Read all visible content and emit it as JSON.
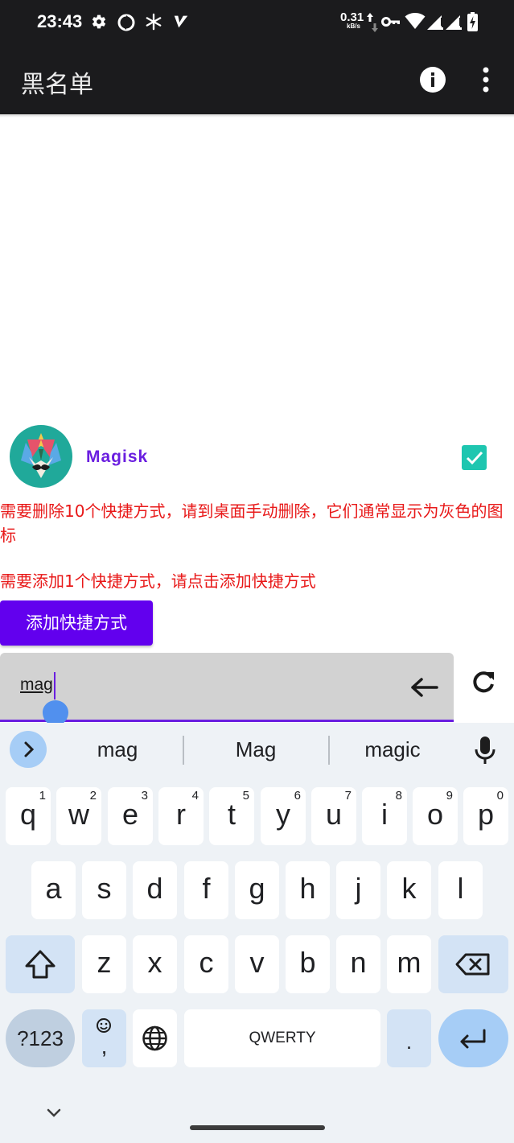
{
  "status_bar": {
    "time": "23:43",
    "net_speed_value": "0.31",
    "net_speed_unit": "kB/s",
    "icons": [
      "settings-icon",
      "sync-icon",
      "snowflake-icon",
      "v-logo-icon",
      "upload-download-icon",
      "vpn-key-icon",
      "wifi-icon",
      "signal-icon",
      "signal-icon",
      "battery-icon"
    ]
  },
  "app_bar": {
    "title": "黑名单",
    "icons": [
      "info-icon",
      "more-vert-icon"
    ]
  },
  "list": {
    "items": [
      {
        "name": "Magisk",
        "checked": true,
        "icon": "magisk-icon"
      }
    ]
  },
  "notices": {
    "remove": "需要删除10个快捷方式，请到桌面手动删除，它们通常显示为灰色的图标",
    "add": "需要添加1个快捷方式，请点击添加快捷方式"
  },
  "add_button": {
    "label": "添加快捷方式"
  },
  "search": {
    "value": "mag"
  },
  "keyboard": {
    "suggestions": [
      "mag",
      "Mag",
      "magic"
    ],
    "row1": [
      {
        "ch": "q",
        "hint": "1"
      },
      {
        "ch": "w",
        "hint": "2"
      },
      {
        "ch": "e",
        "hint": "3"
      },
      {
        "ch": "r",
        "hint": "4"
      },
      {
        "ch": "t",
        "hint": "5"
      },
      {
        "ch": "y",
        "hint": "6"
      },
      {
        "ch": "u",
        "hint": "7"
      },
      {
        "ch": "i",
        "hint": "8"
      },
      {
        "ch": "o",
        "hint": "9"
      },
      {
        "ch": "p",
        "hint": "0"
      }
    ],
    "row2": [
      "a",
      "s",
      "d",
      "f",
      "g",
      "h",
      "j",
      "k",
      "l"
    ],
    "row3": [
      "z",
      "x",
      "c",
      "v",
      "b",
      "n",
      "m"
    ],
    "symbols_key": "?123",
    "emoji_comma_key": ",",
    "space_label": "QWERTY",
    "period_key": ".",
    "accent_color": "#a6cdf6"
  },
  "colors": {
    "app_bar": "#1b1b1d",
    "primary": "#6200ee",
    "app_name": "#6a1ee0",
    "notice": "#e81818",
    "checkbox": "#1ec6b0"
  }
}
